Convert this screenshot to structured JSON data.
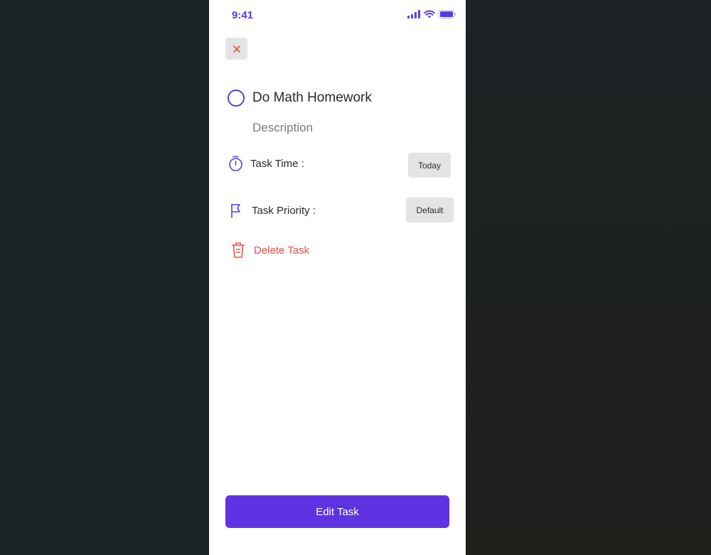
{
  "status_bar": {
    "time": "9:41",
    "icons": [
      "signal-icon",
      "wifi-icon",
      "battery-icon"
    ]
  },
  "header": {
    "close_icon": "close-icon"
  },
  "task": {
    "title": "Do Math Homework",
    "description_placeholder": "Description"
  },
  "properties": {
    "time_label": "Task Time :",
    "time_value": "Today",
    "priority_label": "Task Priority :",
    "priority_value": "Default"
  },
  "actions": {
    "delete_label": "Delete Task",
    "edit_label": "Edit Task"
  },
  "colors": {
    "accent": "#5f33e2",
    "danger": "#e8524c",
    "chip_bg": "#e4e4e6"
  }
}
